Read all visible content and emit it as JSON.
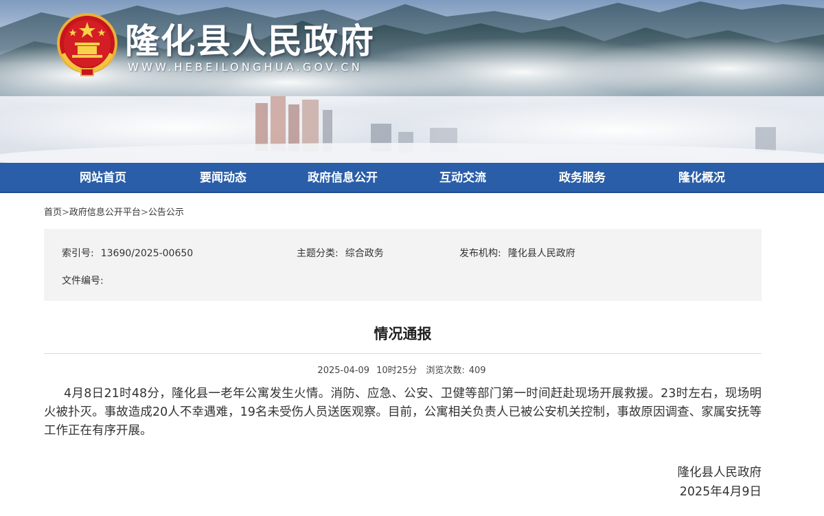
{
  "header": {
    "site_title": "隆化县人民政府",
    "site_url": "WWW.HEBEILONGHUA.GOV.CN",
    "emblem_icon": "national-emblem-icon"
  },
  "nav": {
    "color": "#2a5ea8",
    "items": [
      "网站首页",
      "要闻动态",
      "政府信息公开",
      "互动交流",
      "政务服务",
      "隆化概况"
    ]
  },
  "breadcrumb": {
    "items": [
      "首页",
      "政府信息公开平台",
      "公告公示"
    ],
    "separator": ">"
  },
  "meta": {
    "index_label": "索引号:",
    "index_value": "13690/2025-00650",
    "topic_label": "主题分类:",
    "topic_value": "综合政务",
    "publisher_label": "发布机构:",
    "publisher_value": "隆化县人民政府",
    "docno_label": "文件编号:"
  },
  "article": {
    "title": "情况通报",
    "date": "2025-04-09",
    "time": "10时25分",
    "views_label": "浏览次数:",
    "views": "409",
    "body": "4月8日21时48分，隆化县一老年公寓发生火情。消防、应急、公安、卫健等部门第一时间赶赴现场开展救援。23时左右，现场明火被扑灭。事故造成20人不幸遇难，19名未受伤人员送医观察。目前，公寓相关负责人已被公安机关控制，事故原因调查、家属安抚等工作正在有序开展。",
    "signature_org": "隆化县人民政府",
    "signature_date": "2025年4月9日"
  }
}
